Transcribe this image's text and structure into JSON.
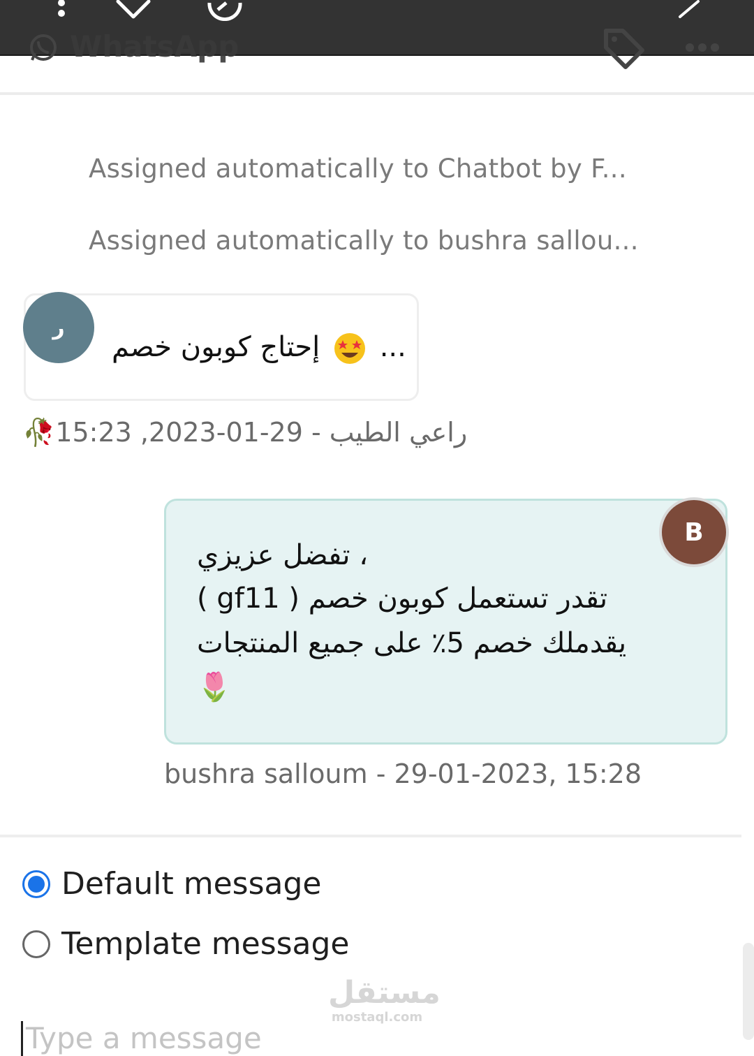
{
  "header": {
    "app_title": "WhatsApp"
  },
  "system_messages": [
    "Assigned automatically to Chatbot by F...",
    "Assigned automatically to bushra sallou..."
  ],
  "incoming": {
    "avatar_initial": "ر",
    "text_prefix": "...",
    "text_body": "إحتاج كوبون خصم",
    "sender_name": "🥀راعي الطيب",
    "timestamp": " - 29-01-2023, 15:23"
  },
  "outgoing": {
    "avatar_initial": "B",
    "lines": [
      "تفضل عزيزي ،",
      "( gf11 ) تقدر تستعمل كوبون خصم",
      "يقدملك خصم 5٪ على جميع المنتجات",
      "🌷"
    ],
    "meta": "bushra salloum  - 29-01-2023, 15:28"
  },
  "message_type": {
    "options": [
      "Default message",
      "Template message"
    ],
    "selected": "Default message"
  },
  "composer": {
    "placeholder": "Type a message"
  },
  "watermark": {
    "arabic": "مستقل",
    "latin": "mostaql.com"
  },
  "colors": {
    "toolbar": "#333333",
    "incoming_avatar": "#5f7f8c",
    "outgoing_avatar": "#7c4a3a",
    "outgoing_bubble": "#e6f3f3",
    "radio_selected": "#1a73e8"
  }
}
